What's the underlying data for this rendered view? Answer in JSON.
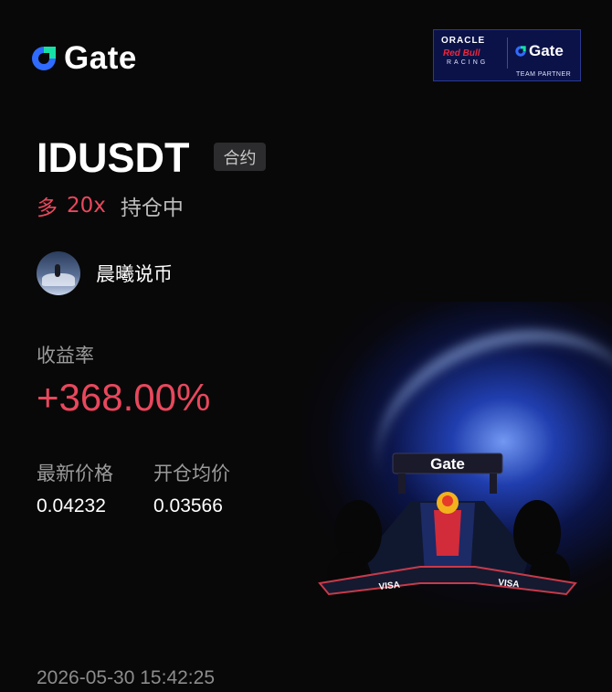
{
  "brand": {
    "name": "Gate",
    "logo_icon": "gate-logo-icon"
  },
  "partner_badge": {
    "line1": "ORACLE",
    "line2": "Red Bull",
    "line3": "RACING",
    "gate": "Gate",
    "caption": "TEAM PARTNER"
  },
  "position": {
    "symbol": "IDUSDT",
    "type_tag": "合约",
    "side": "多",
    "leverage": "20x",
    "status": "持仓中"
  },
  "user": {
    "name": "晨曦说币",
    "avatar_icon": "user-avatar"
  },
  "roi": {
    "label": "收益率",
    "value": "+368.00%"
  },
  "prices": {
    "latest_label": "最新价格",
    "latest_value": "0.04232",
    "entry_label": "开仓均价",
    "entry_value": "0.03566"
  },
  "timestamp": "2026-05-30 15:42:25",
  "car": {
    "wing_text": "Gate",
    "icon": "race-car-image"
  },
  "colors": {
    "profit": "#e9475d",
    "background": "#080808",
    "accent_blue": "#2f6bff"
  }
}
